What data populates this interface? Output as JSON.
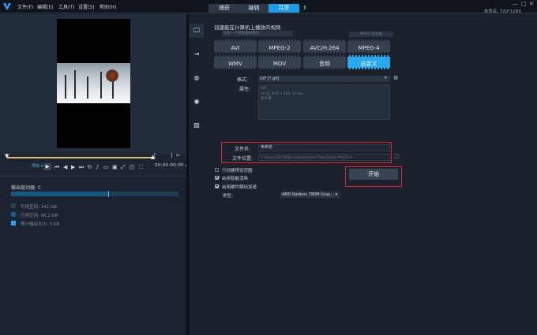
{
  "menu": [
    "文件(F)",
    "编辑(E)",
    "工具(T)",
    "设置(S)",
    "帮助(H)"
  ],
  "mode_tabs": [
    "捕获",
    "编辑",
    "共享"
  ],
  "project_info": "未命名, 720*1280",
  "window_controls": [
    "—",
    "□",
    "✕"
  ],
  "player": {
    "project_btn": "项目 ▾",
    "timecode": "00:00:00:00 ▴▾"
  },
  "output": {
    "label": "输出驱动器: C",
    "used_fraction": 0.58,
    "legend": [
      {
        "label": "可用空间: 141 GB",
        "color": "#23435b"
      },
      {
        "label": "已用空间: 98.2 GB",
        "color": "#1a5c84"
      },
      {
        "label": "预计输出大小: 0 KB",
        "color": "#2aa8ee"
      }
    ]
  },
  "share": {
    "title": "创建能在计算机上播放的视频",
    "preset_placeholder": "与第一个视频素材相同",
    "setting_pill": "MPEG 优化器",
    "formats_row1": [
      "AVI",
      "MPEG-2",
      "AVC/H.264",
      "MPEG-4"
    ],
    "formats_row2": [
      "WMV",
      "MOV",
      "音频",
      "自定义"
    ],
    "active_format": "自定义",
    "format_label": "格式:",
    "format_value": "GIF [*.gif]",
    "properties_label": "属性:",
    "properties_lines": [
      "GIF",
      "24 位, 640 x 360, 10 fps",
      "基于帧"
    ],
    "filename_label": "文件名:",
    "filename_value": "未命名",
    "filelocation_label": "文件位置:",
    "filelocation_value": "C:\\Users\\15578\\Documents\\Corel VideoStudio Pro\\26.0\\",
    "options": [
      {
        "label": "只创建预览范围",
        "checked": false
      },
      {
        "label": "启用智能渲染",
        "checked": true
      },
      {
        "label": "启用硬件解码加速",
        "checked": true
      }
    ],
    "type_label": "类型:",
    "gpu_value": "AMD Radeon 780M Grap... ▾",
    "start_button": "开始"
  },
  "colors": {
    "accent": "#2aa8ee",
    "highlight_box": "#e0252e",
    "background": "#1b2330"
  }
}
